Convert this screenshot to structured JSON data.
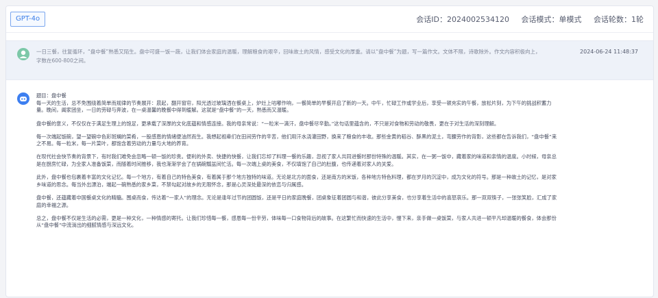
{
  "topbar": {
    "model": "GPT-4o",
    "session_id": "会话ID：2024002534120",
    "mode": "会话模式：单模式",
    "rounds": "会话轮数：1轮"
  },
  "user_message": {
    "text": "一日三餐，往复循环，“盘中餐”熟悉又陌生。盘中可盛一饭一蔬，让我们体会家庭的温暖，理解粮食的艰辛，回味故土的风情，感受文化的厚重。请以“盘中餐”为题，写一篇作文。文体不限，诗歌除外。作文内容积极向上，字数在600-800之间。",
    "timestamp": "2024-06-24 11:48:37"
  },
  "assistant_message": {
    "title": "题目：盘中餐",
    "paragraphs": [
      "每一天的生活，总不免围绕着简单而规律的节奏展开：晨起，翻开窗帘，阳光透过玻璃洒在餐桌上，炉灶上咕嘟作响，一餐简单的早餐开启了新的一天。中午，忙碌工作或学业后，享受一顿充实的午餐，放松片刻，为下午的挑战积蓄力量。晚间，阖家团坐，一日的劳碌与奔波，在一桌温馨的晚餐中得到缓解。这就是“盘中餐”的一天，熟悉而又温暖。",
      "盘中餐的意义，不仅仅在于满足生理上的饱足，更承载了深厚的文化底蕴和情感连接。我的母亲常说：“一粒米一滴汗，盘中餐尽辛勤。”这句话里蕴含的，不只是对食物和劳动的敬畏，更在于对生活的深刻理解。",
      "每一次端起饭碗，望一望碗中色彩斑斓的菜肴，一股感恩的情绪便油然而生。我想起祖辈们在田间劳作的辛苦，他们用汗水浇灌田野，换来了粮食的丰收。那些金黄的稻谷、酥黑的泥土，弯腰劳作的背影，这些都在告诉我们，“盘中餐”来之不易。每一粒米，每一片菜叶，都饱含着劳动的力量与大地的养育。",
      "在现代社会快节奏的背景下，有时我们难免会忽略一顿一饭的珍贵。便利的外卖、快捷的快餐，让我们忘却了料理一餐的乐趣，忽视了家人共同进餐时那份特殊的温暖。其实，在一粥一饭中，藏着家的味道和亲情的温度。小时候，母亲总是在厨房忙碌，为全家人准备饭菜，而随着时间推移，我也渐渐学会了在锅碗瓢盆间忙活。每一次端上桌的美食，不仅填饱了自己的肚腹，也传递着对家人的关爱。",
      "此外，盘中餐也包裹着丰富的文化记忆。每一个地方，有着自己的特色美食，有着属于那个地方独特的味道。无论是北方的面食，还是南方的米饭，各种地方特色料理，都在岁月的沉淀中，成为文化的符号。那是一种故土的记忆，是对家乡味道的思念。每当外出漂泊，端起一碗熟悉的家乡菜，不禁勾起对故乡的无限怀念，那是心灵深处最深的依恋与归属感。",
      "盘中餐，还蕴藏着中国餐桌文化的精髓。围桌而食，传达着“一家人”的理念。无论是逢年过节的团圆饭，还是平日的家庭晚餐，团桌象征着团圆与和谐，彼此分享美食，也分享着生活中的喜怒哀乐。那一双双筷子，一张张笑脸，汇成了家庭的幸福之源。",
      "总之，盘中餐不仅是生活的必需，更是一种文化，一种情感的寄托。让我们珍惜每一餐，感恩每一份辛劳，体味每一口食物背后的故事。在这繁忙而快速的生活中，慢下来，亲手做一桌饭菜，与家人共进一顿平凡却温暖的餐食，体会那份从“盘中餐”中流淌出的细腻情感与深远文化。"
    ]
  },
  "icons": {
    "user_avatar": "user-avatar-icon",
    "bot_avatar": "robot-avatar-icon"
  },
  "colors": {
    "accent": "#3b7ee8",
    "user_avatar": "#7cc8a8",
    "bot_avatar": "#3d7ff0"
  }
}
